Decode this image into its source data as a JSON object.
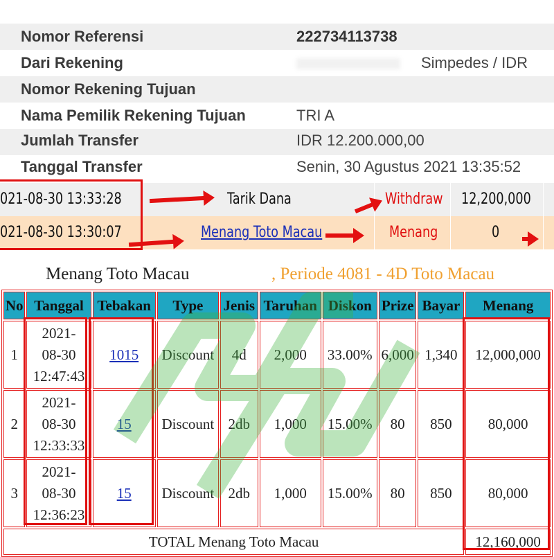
{
  "receipt": {
    "rows": [
      {
        "label": "Nomor Referensi",
        "value": "222734113738"
      },
      {
        "label": "Dari Rekening",
        "value": "Simpedes / IDR"
      },
      {
        "label": "Nomor Rekening Tujuan",
        "value": ""
      },
      {
        "label": "Nama Pemilik Rekening Tujuan",
        "value": "TRI A"
      },
      {
        "label": "Jumlah Transfer",
        "value": "IDR 12.200.000,00"
      },
      {
        "label": "Tanggal Transfer",
        "value": "Senin, 30 Agustus 2021 13:35:52"
      }
    ]
  },
  "transactions": [
    {
      "datetime": "021-08-30 13:33:28",
      "description": "Tarik Dana",
      "status": "Withdraw",
      "amount": "12,200,000"
    },
    {
      "datetime": "021-08-30 13:30:07",
      "description": "Menang Toto Macau",
      "status": "Menang",
      "amount": "0"
    }
  ],
  "bet_table": {
    "title": "Menang Toto Macau",
    "period": ", Periode 4081 - 4D Toto Macau",
    "columns": [
      "No",
      "Tanggal",
      "Tebakan",
      "Type",
      "Jenis",
      "Taruhan",
      "Diskon",
      "Prize",
      "Bayar",
      "Menang"
    ],
    "rows": [
      {
        "no": "1",
        "date": "2021-",
        "date2": "08-30",
        "time": "12:47:43",
        "guess": "1015",
        "type": "Discount",
        "jenis": "4d",
        "bet": "2,000",
        "discount": "33.00%",
        "prize": "6,000",
        "pay": "1,340",
        "win": "12,000,000"
      },
      {
        "no": "2",
        "date": "2021-",
        "date2": "08-30",
        "time": "12:33:33",
        "guess": "15",
        "type": "Discount",
        "jenis": "2db",
        "bet": "1,000",
        "discount": "15.00%",
        "prize": "80",
        "pay": "850",
        "win": "80,000"
      },
      {
        "no": "3",
        "date": "2021-",
        "date2": "08-30",
        "time": "12:36:23",
        "guess": "15",
        "type": "Discount",
        "jenis": "2db",
        "bet": "1,000",
        "discount": "15.00%",
        "prize": "80",
        "pay": "850",
        "win": "80,000"
      }
    ],
    "total_label": "TOTAL  Menang Toto Macau",
    "total_value": "12,160,000"
  },
  "colors": {
    "header_bg": "#1fa6c2",
    "highlight_red": "#e01010",
    "period_orange": "#f0a030",
    "row_shade": "#efefef",
    "tx_highlight": "#fde0c0",
    "link_blue": "#1a2fb8"
  }
}
